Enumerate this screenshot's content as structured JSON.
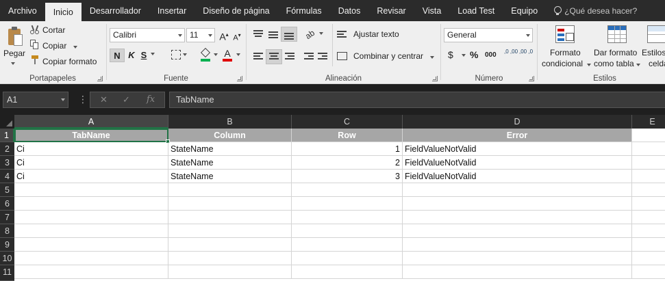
{
  "tabs": [
    {
      "label": "Archivo",
      "active": false
    },
    {
      "label": "Inicio",
      "active": true
    },
    {
      "label": "Desarrollador",
      "active": false
    },
    {
      "label": "Insertar",
      "active": false
    },
    {
      "label": "Diseño de página",
      "active": false
    },
    {
      "label": "Fórmulas",
      "active": false
    },
    {
      "label": "Datos",
      "active": false
    },
    {
      "label": "Revisar",
      "active": false
    },
    {
      "label": "Vista",
      "active": false
    },
    {
      "label": "Load Test",
      "active": false
    },
    {
      "label": "Equipo",
      "active": false
    }
  ],
  "search": {
    "placeholder": "¿Qué desea hacer?"
  },
  "ribbon": {
    "clipboard": {
      "label": "Portapapeles",
      "paste": "Pegar",
      "cut": "Cortar",
      "copy": "Copiar",
      "format_painter": "Copiar formato"
    },
    "font": {
      "label": "Fuente",
      "name": "Calibri",
      "size": "11",
      "grow": "A",
      "shrink": "A",
      "bold": "N",
      "italic": "K",
      "underline": "S",
      "font_color_letter": "A",
      "fill_color": "#00b050",
      "font_color": "#e00000"
    },
    "alignment": {
      "label": "Alineación",
      "wrap": "Ajustar texto",
      "merge": "Combinar y centrar"
    },
    "number": {
      "label": "Número",
      "format": "General",
      "currency": "$",
      "percent": "%",
      "thousands": "000",
      "inc_decimal": ",0 ,00",
      "dec_decimal": ",00 ,0"
    },
    "styles": {
      "label": "Estilos",
      "conditional_line1": "Formato",
      "conditional_line2": "condicional",
      "table_line1": "Dar formato",
      "table_line2": "como tabla",
      "cell_line1": "Estilos",
      "cell_line2": "celda"
    }
  },
  "formula_bar": {
    "cell_ref": "A1",
    "value": "TabName",
    "fx": "fx",
    "cancel": "✕",
    "enter": "✓"
  },
  "sheet": {
    "columns": [
      "A",
      "B",
      "C",
      "D",
      "E"
    ],
    "rows": [
      "1",
      "2",
      "3",
      "4",
      "5",
      "6",
      "7",
      "8",
      "9",
      "10",
      "11"
    ],
    "header": [
      "TabName",
      "Column",
      "Row",
      "Error"
    ],
    "data": [
      [
        "Ci",
        "StateName",
        "1",
        "FieldValueNotValid"
      ],
      [
        "Ci",
        "StateName",
        "2",
        "FieldValueNotValid"
      ],
      [
        "Ci",
        "StateName",
        "3",
        "FieldValueNotValid"
      ]
    ]
  },
  "colors": {
    "accent": "#217346",
    "header_fill": "#a6a6a6"
  }
}
